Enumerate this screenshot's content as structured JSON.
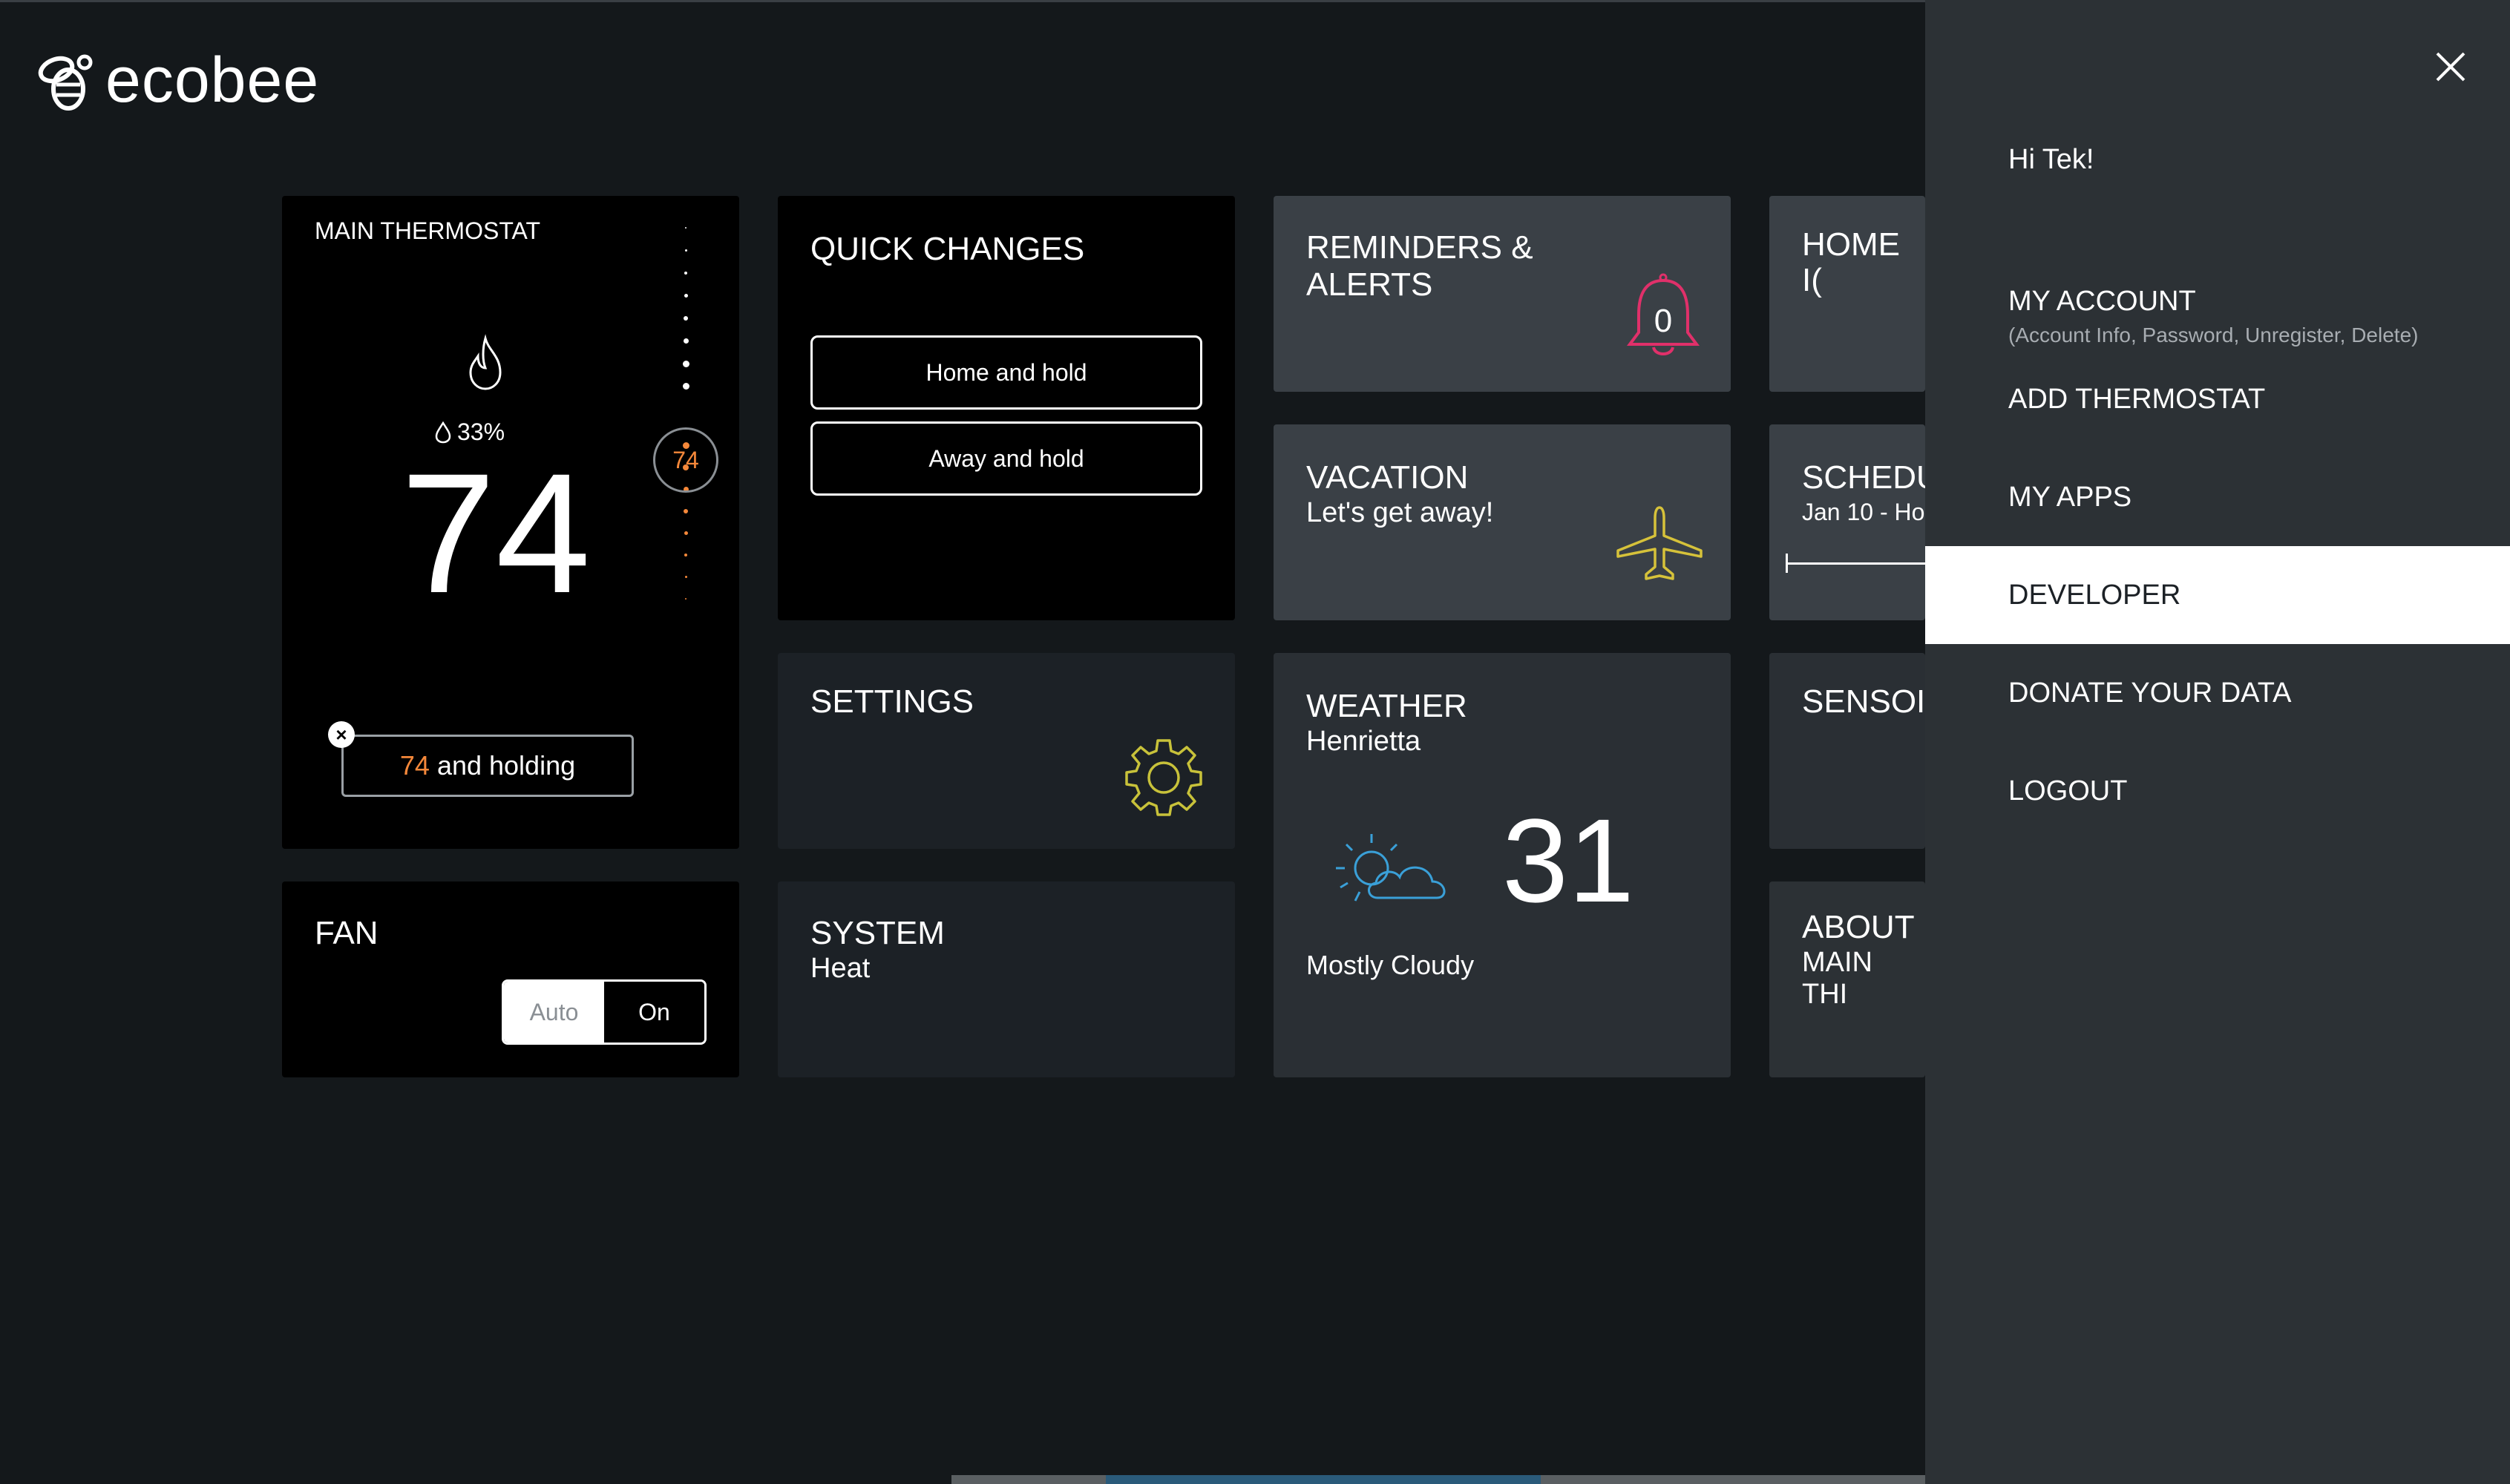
{
  "brand": {
    "name": "ecobee"
  },
  "thermostat": {
    "title": "MAIN THERMOSTAT",
    "humidity": "33%",
    "current_temp": "74",
    "setpoint": "74",
    "hold_temp": "74",
    "hold_text": "and holding",
    "accent_color": "#f5883a"
  },
  "quick_changes": {
    "title": "QUICK CHANGES",
    "buttons": [
      "Home and hold",
      "Away and hold"
    ]
  },
  "reminders": {
    "title_line1": "REMINDERS &",
    "title_line2": "ALERTS",
    "count": "0"
  },
  "home_iq": {
    "title": "HOME I("
  },
  "settings": {
    "title": "SETTINGS"
  },
  "vacation": {
    "title": "VACATION",
    "subtitle": "Let's get away!"
  },
  "schedule": {
    "title": "SCHEDU",
    "subtitle": "Jan 10 - Ho"
  },
  "fan": {
    "title": "FAN",
    "options": [
      "Auto",
      "On"
    ],
    "selected": "On"
  },
  "system": {
    "title": "SYSTEM",
    "mode": "Heat"
  },
  "weather": {
    "title": "WEATHER",
    "location": "Henrietta",
    "temp": "31",
    "condition": "Mostly Cloudy"
  },
  "sensors": {
    "title": "SENSOI"
  },
  "about": {
    "title": "ABOUT",
    "subtitle": "MAIN THI"
  },
  "side_menu": {
    "greeting": "Hi Tek!",
    "items": [
      {
        "label": "MY ACCOUNT",
        "sub": "(Account Info, Password, Unregister, Delete)"
      },
      {
        "label": "ADD THERMOSTAT"
      },
      {
        "label": "MY APPS"
      },
      {
        "label": "DEVELOPER",
        "active": true
      },
      {
        "label": "DONATE YOUR DATA"
      },
      {
        "label": "LOGOUT"
      }
    ]
  }
}
